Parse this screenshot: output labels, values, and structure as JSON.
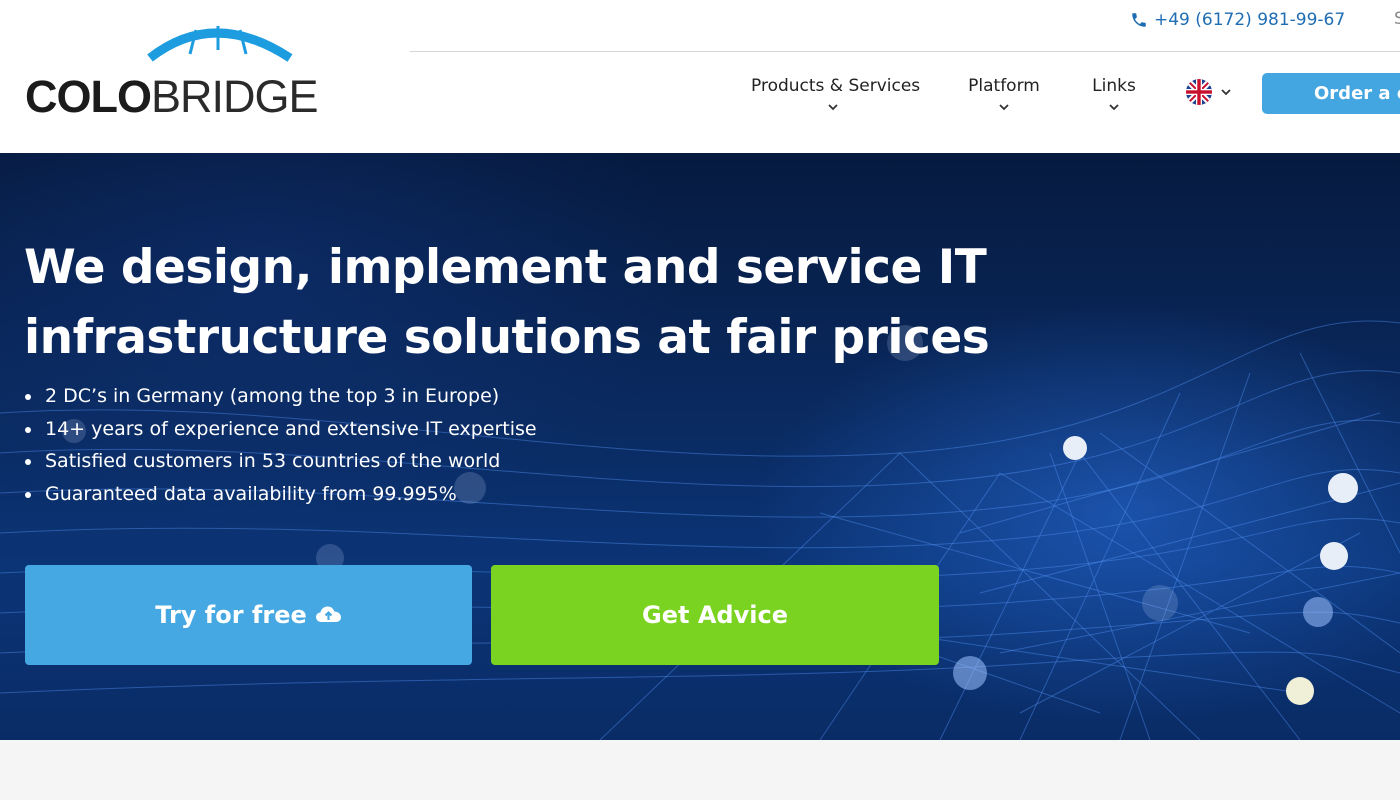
{
  "brand": {
    "logo_text_bold": "COLO",
    "logo_text_light": "BRIDGE",
    "accent_color": "#1e9ce0"
  },
  "topbar": {
    "phone_icon": "phone-icon",
    "phone": "+49 (6172) 981-99-67",
    "cut_text": "S"
  },
  "nav": {
    "items": [
      {
        "label": "Products & Services",
        "icon": "chevron-down-icon"
      },
      {
        "label": "Platform",
        "icon": "chevron-down-icon"
      },
      {
        "label": "Links",
        "icon": "chevron-down-icon"
      }
    ],
    "language": {
      "flag": "uk-flag-icon",
      "icon": "chevron-down-icon"
    },
    "order_button": "Order a ca"
  },
  "hero": {
    "heading": "We design, implement and service IT infrastructure solutions at fair prices",
    "bullets": [
      "2 DC’s in Germany (among the top 3 in Europe)",
      "14+ years of experience and extensive IT expertise",
      "Satisfied customers in 53 countries of the world",
      "Guaranteed data availability from 99.995%"
    ],
    "try_button": "Try for free",
    "try_icon": "cloud-upload-icon",
    "advice_button": "Get Advice",
    "colors": {
      "try": "#45a8e2",
      "advice": "#7bd321",
      "order": "#44a6e0"
    }
  }
}
